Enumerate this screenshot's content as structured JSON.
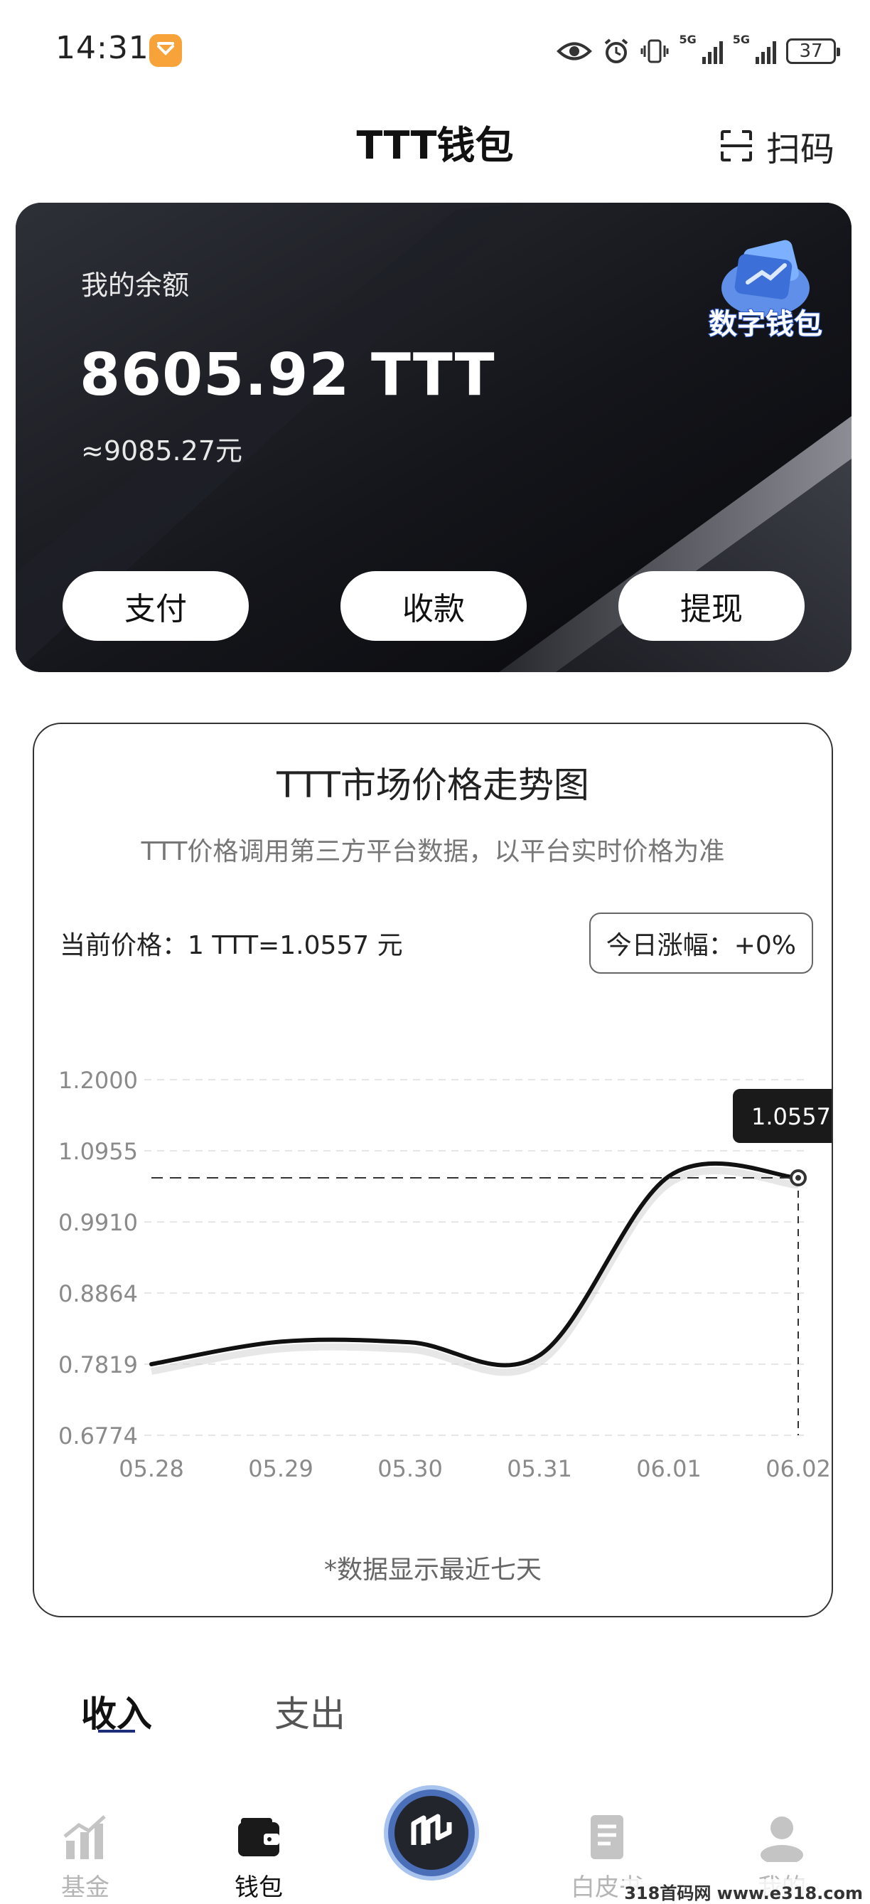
{
  "status_bar": {
    "time": "14:31",
    "battery": "37",
    "net1": "5G",
    "net2": "5G"
  },
  "header": {
    "title": "TTT钱包",
    "scan_label": "扫码"
  },
  "balance_card": {
    "label": "我的余额",
    "value": "8605.92 TTT",
    "cny_value": "≈9085.27元",
    "badge_text": "数字钱包",
    "buttons": {
      "pay": "支付",
      "receive": "收款",
      "withdraw": "提现"
    }
  },
  "chart_card": {
    "title": "TTT市场价格走势图",
    "subtitle": "TTT价格调用第三方平台数据，以平台实时价格为准",
    "current_price": "当前价格：1 TTT=1.0557 元",
    "today_change": "今日涨幅：+0%",
    "footnote": "*数据显示最近七天"
  },
  "chart_data": {
    "type": "line",
    "x": [
      "05.28",
      "05.29",
      "05.30",
      "05.31",
      "06.01",
      "06.02"
    ],
    "y": [
      0.7819,
      0.815,
      0.814,
      0.795,
      1.058,
      1.0557
    ],
    "yticks": [
      "1.2000",
      "1.0955",
      "0.9910",
      "0.8864",
      "0.7819",
      "0.6774"
    ],
    "ylim": [
      0.6774,
      1.2
    ],
    "tooltip": "1.0557",
    "grid": true
  },
  "tabs": {
    "income": "收入",
    "expense": "支出"
  },
  "nav": {
    "fund": "基金",
    "wallet": "钱包",
    "whitepaper": "白皮书",
    "mine": "我的"
  },
  "watermark": "318首码网 www.e318.com",
  "colors": {
    "card_bg": "#0d0e13",
    "accent": "#1d2f7a",
    "center_button": "#4a6fb8",
    "app_badge": "#f7a33a"
  }
}
